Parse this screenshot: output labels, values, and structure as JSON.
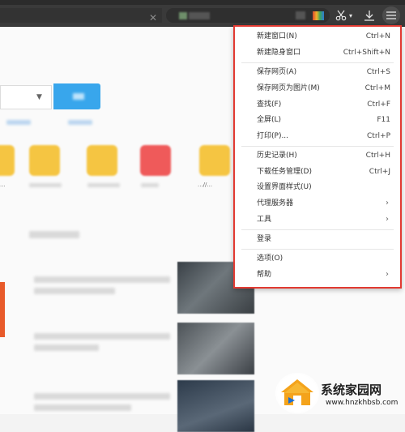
{
  "menu": {
    "items": [
      {
        "label": "新建窗口(N)",
        "shortcut": "Ctrl+N"
      },
      {
        "label": "新建隐身窗口",
        "shortcut": "Ctrl+Shift+N"
      },
      {
        "label": "保存网页(A)",
        "shortcut": "Ctrl+S"
      },
      {
        "label": "保存网页为图片(M)",
        "shortcut": "Ctrl+M"
      },
      {
        "label": "查找(F)",
        "shortcut": "Ctrl+F"
      },
      {
        "label": "全屏(L)",
        "shortcut": "F11"
      },
      {
        "label": "打印(P)...",
        "shortcut": "Ctrl+P"
      },
      {
        "label": "历史记录(H)",
        "shortcut": "Ctrl+H"
      },
      {
        "label": "下载任务管理(D)",
        "shortcut": "Ctrl+J"
      },
      {
        "label": "设置界面样式(U)",
        "shortcut": ""
      },
      {
        "label": "代理服务器",
        "shortcut": "",
        "submenu": true
      },
      {
        "label": "工具",
        "shortcut": "",
        "submenu": true
      },
      {
        "label": "登录",
        "shortcut": ""
      },
      {
        "label": "选项(O)",
        "shortcut": ""
      },
      {
        "label": "帮助",
        "shortcut": "",
        "submenu": true
      }
    ]
  },
  "page": {
    "site_labels": [
      "...",
      "...//..."
    ]
  },
  "watermark": {
    "title": "系统家园网",
    "url": "www.hnzkhbsb.com"
  },
  "colors": {
    "menu_border": "#e23a32",
    "search_button": "#38a6ec",
    "toolbar": "#3a3a3a"
  },
  "icons": [
    "close-icon",
    "cut-icon",
    "download-icon",
    "menu-icon",
    "dropdown-caret-icon",
    "submenu-arrow-icon"
  ]
}
